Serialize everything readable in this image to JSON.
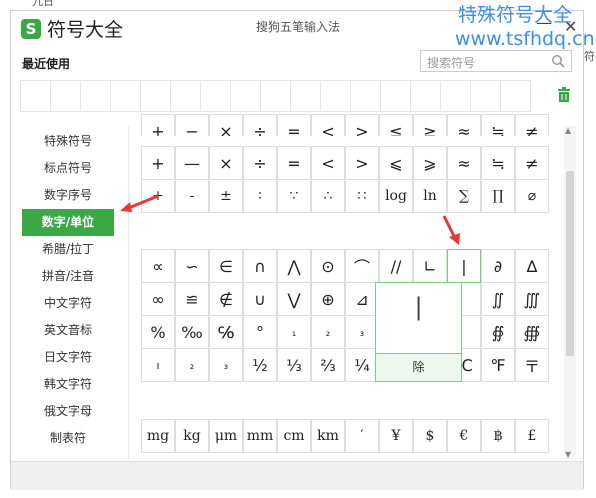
{
  "outer_top_text": "九日",
  "app_title": "符号大全",
  "window_title": "搜狗五笔输入法",
  "watermark_line1": "特殊符号大全",
  "watermark_line2": "www.tsfhdq.cn",
  "side_cut_text": "符",
  "close_glyph": "✕",
  "minimize_glyph": "—",
  "recent_label": "最近使用",
  "search": {
    "placeholder": "搜索符号"
  },
  "sidebar": [
    {
      "label": "特殊符号"
    },
    {
      "label": "标点符号"
    },
    {
      "label": "数字序号"
    },
    {
      "label": "数字/单位",
      "active": true
    },
    {
      "label": "希腊/拉丁"
    },
    {
      "label": "拼音/注音"
    },
    {
      "label": "中文字符"
    },
    {
      "label": "英文音标"
    },
    {
      "label": "日文字符"
    },
    {
      "label": "韩文字符"
    },
    {
      "label": "俄文字母"
    },
    {
      "label": "制表符"
    }
  ],
  "grid_top_partial": [
    "+",
    "−",
    "×",
    "÷",
    "=",
    "<",
    ">",
    "≤",
    "≥",
    "≈",
    "≒",
    "≠"
  ],
  "grid_math": [
    [
      "+",
      "—",
      "×",
      "÷",
      "=",
      "<",
      ">",
      "⩽",
      "⩾",
      "≈",
      "≒",
      "≠"
    ],
    [
      "+",
      "-",
      "±",
      "∶",
      "∵",
      "∴",
      "∷",
      "log",
      "ln",
      "∑",
      "∏",
      "⌀"
    ]
  ],
  "grid_symbols": [
    [
      "∝",
      "∽",
      "∈",
      "∩",
      "⋀",
      "⊙",
      "⌒",
      "//",
      "∟",
      "|",
      "∂",
      "∆"
    ],
    [
      "∞",
      "≌",
      "∉",
      "∪",
      "⋁",
      "⊕",
      "⊿",
      "",
      "",
      "",
      "∬",
      "∭"
    ],
    [
      "%",
      "‰",
      "℅",
      "°",
      "₁",
      "₂",
      "₃",
      "",
      "",
      "",
      "∯",
      "∰"
    ],
    [
      "ı",
      "₂",
      "₃",
      "½",
      "⅓",
      "⅔",
      "¼",
      "",
      "",
      "℃",
      "℉",
      "〒"
    ]
  ],
  "grid_units": [
    "mg",
    "kg",
    "μm",
    "mm",
    "cm",
    "km",
    "′",
    "¥",
    "$",
    "€",
    "฿",
    "£"
  ],
  "popup": {
    "char": "|",
    "action": "除"
  },
  "recent_cells": 17
}
